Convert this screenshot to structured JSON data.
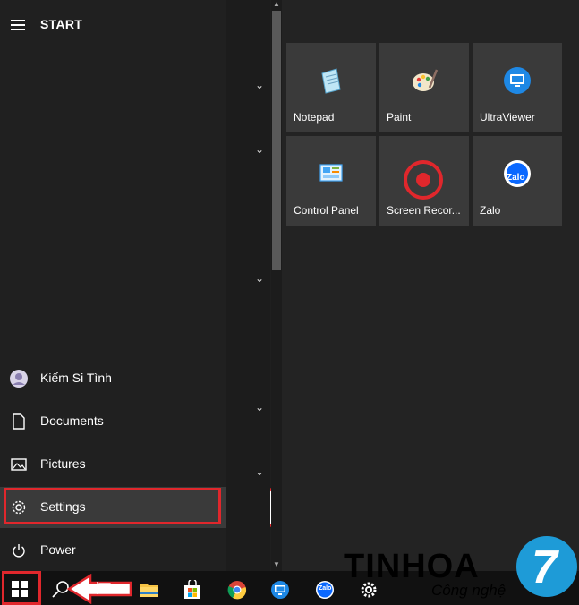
{
  "start_menu": {
    "title": "START",
    "nav": [
      {
        "label": "Kiếm Si Tình",
        "icon": "user-avatar-icon"
      },
      {
        "label": "Documents",
        "icon": "document-icon"
      },
      {
        "label": "Pictures",
        "icon": "pictures-icon"
      },
      {
        "label": "Settings",
        "icon": "gear-icon"
      },
      {
        "label": "Power",
        "icon": "power-icon"
      }
    ]
  },
  "tiles": [
    {
      "label": "Notepad",
      "icon": "notepad-icon"
    },
    {
      "label": "Paint",
      "icon": "paint-icon"
    },
    {
      "label": "UltraViewer",
      "icon": "ultraviewer-icon"
    },
    {
      "label": "Control Panel",
      "icon": "control-panel-icon"
    },
    {
      "label": "Screen Recor...",
      "icon": "screen-recorder-icon"
    },
    {
      "label": "Zalo",
      "icon": "zalo-icon"
    }
  ],
  "taskbar": {
    "icons": [
      "windows-start-icon",
      "search-icon",
      "task-view-icon",
      "file-explorer-icon",
      "store-icon",
      "chrome-icon",
      "ultraviewer-icon",
      "zalo-icon",
      "settings-icon"
    ],
    "zalo_text": "Zalo"
  },
  "watermark": {
    "brand": "TINHOA",
    "tagline": "Công nghệ",
    "logo_digit": "7"
  },
  "colors": {
    "highlight": "#e0272c",
    "accent_blue": "#1e9bd7",
    "tile_bg": "#3a3a3a"
  }
}
